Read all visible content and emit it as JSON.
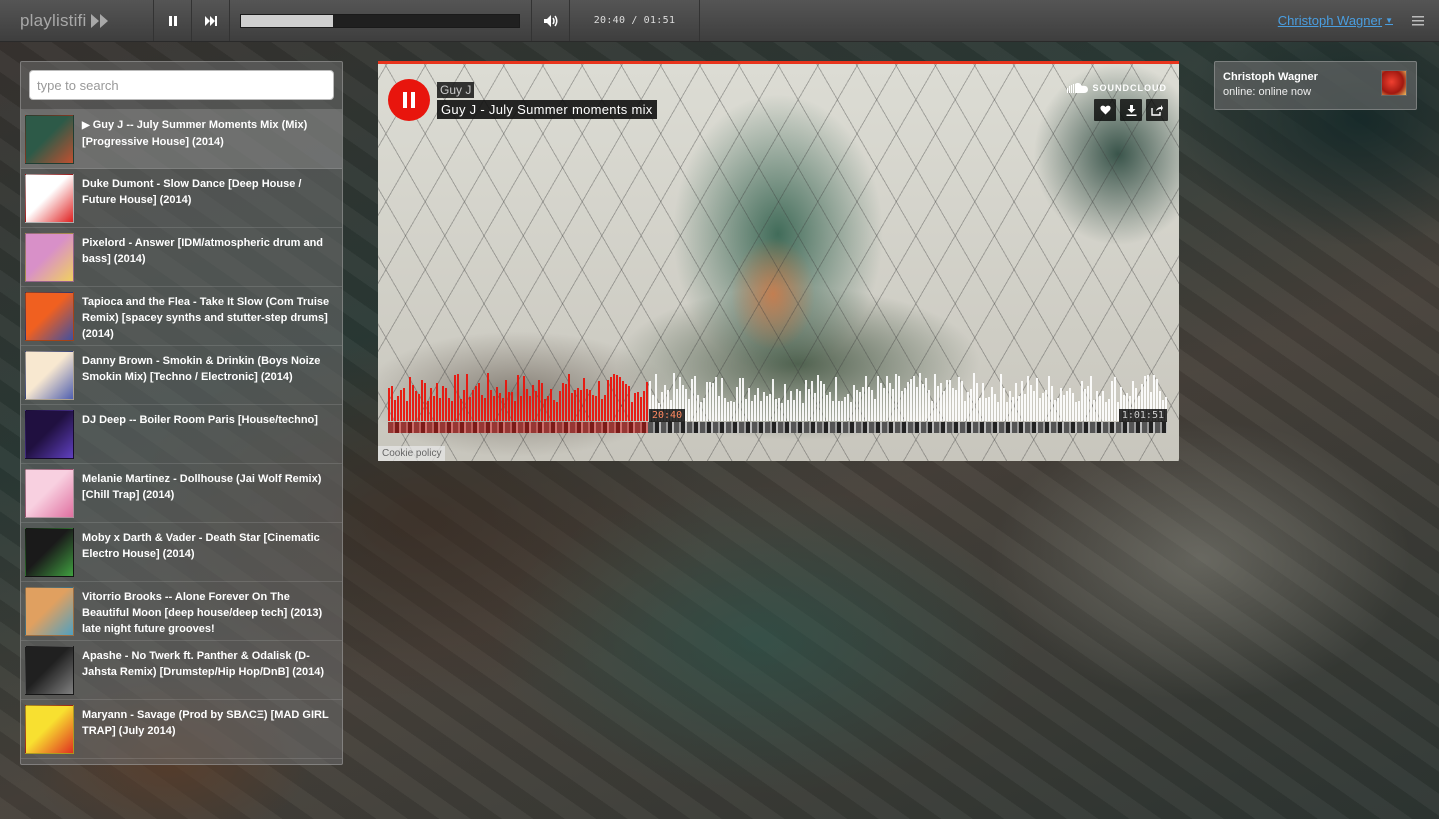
{
  "brand": {
    "name": "playlistifi"
  },
  "player_bar": {
    "progress_fraction": 0.33,
    "current_time": "20:40",
    "separator": "/",
    "total_time": "01:51"
  },
  "user": {
    "name": "Christoph Wagner",
    "status_label": "online:",
    "status_value": "online now"
  },
  "search": {
    "placeholder": "type to search"
  },
  "tracks": [
    {
      "title": "Guy J -- July Summer Moments Mix (Mix) [Progressive House] (2014)",
      "playing": true,
      "thumb_colors": [
        "#2d5a48",
        "#c05030"
      ]
    },
    {
      "title": "Duke Dumont - Slow Dance [Deep House / Future House] (2014)",
      "playing": false,
      "thumb_colors": [
        "#ffffff",
        "#e02020"
      ]
    },
    {
      "title": "Pixelord - Answer [IDM/atmospheric drum and bass] (2014)",
      "playing": false,
      "thumb_colors": [
        "#d890c8",
        "#f0d060"
      ]
    },
    {
      "title": "Tapioca and the Flea - Take It Slow (Com Truise Remix) [spacey synths and stutter-step drums] (2014)",
      "playing": false,
      "thumb_colors": [
        "#f06020",
        "#4050a0"
      ]
    },
    {
      "title": "Danny Brown - Smokin & Drinkin (Boys Noize Smokin Mix) [Techno / Electronic] (2014)",
      "playing": false,
      "thumb_colors": [
        "#f8e8d0",
        "#5060b0"
      ]
    },
    {
      "title": "DJ Deep -- Boiler Room Paris [House/techno]",
      "playing": false,
      "thumb_colors": [
        "#201040",
        "#6040c0"
      ]
    },
    {
      "title": "Melanie Martinez - Dollhouse (Jai Wolf Remix) [Chill Trap] (2014)",
      "playing": false,
      "thumb_colors": [
        "#f8d0e0",
        "#e070a0"
      ]
    },
    {
      "title": "Moby x Darth & Vader - Death Star [Cinematic Electro House] (2014)",
      "playing": false,
      "thumb_colors": [
        "#1a1a1a",
        "#40a040"
      ]
    },
    {
      "title": "Vitorrio Brooks -- Alone Forever On The Beautiful Moon [deep house/deep tech] (2013) late night future grooves!",
      "playing": false,
      "thumb_colors": [
        "#e0a060",
        "#50a0c0"
      ]
    },
    {
      "title": "Apashe - No Twerk ft. Panther & Odalisk (D-Jahsta Remix) [Drumstep/Hip Hop/DnB] (2014)",
      "playing": false,
      "thumb_colors": [
        "#202020",
        "#808080"
      ]
    },
    {
      "title": "Maryann - Savage (Prod by SBΛCΞ) [MAD GIRL TRAP] (July 2014)",
      "playing": false,
      "thumb_colors": [
        "#f8e030",
        "#e03020"
      ]
    }
  ],
  "embed": {
    "artist": "Guy J",
    "title": "Guy J - July Summer moments mix",
    "provider": "SOUNDCLOUD",
    "current_time": "20:40",
    "total_time": "1:01:51",
    "progress_fraction": 0.334,
    "cookie_label": "Cookie policy",
    "accent_color": "#e8150d"
  }
}
